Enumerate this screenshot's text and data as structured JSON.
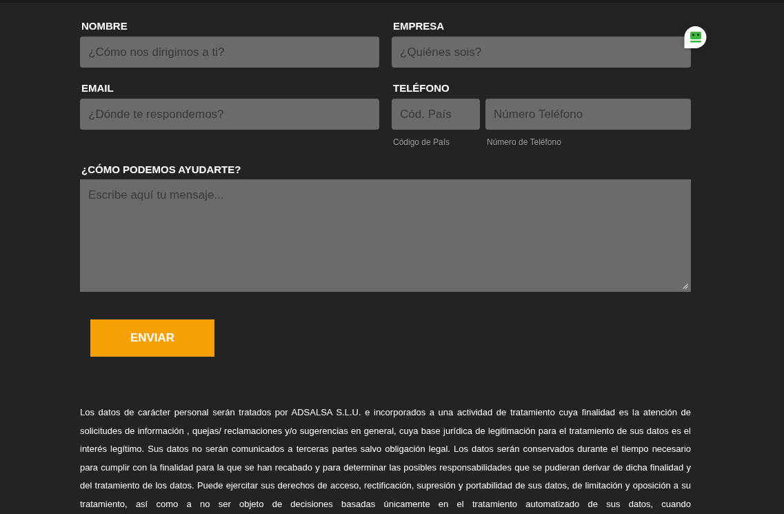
{
  "form": {
    "fields": [
      {
        "label": "NOMBRE",
        "kind": "text",
        "inputs": [
          {
            "placeholder": "¿Cómo nos dirigimos a ti?"
          }
        ]
      },
      {
        "label": "EMPRESA",
        "kind": "text",
        "inputs": [
          {
            "placeholder": "¿Quiénes sois?"
          }
        ]
      },
      {
        "label": "EMAIL",
        "kind": "text",
        "inputs": [
          {
            "placeholder": "¿Dónde te respondemos?"
          }
        ]
      },
      {
        "label": "TELÉFONO",
        "kind": "phone",
        "inputs": [
          {
            "placeholder": "Cód. País",
            "hint": "Código de País"
          },
          {
            "placeholder": "Número Teléfono",
            "hint": "Número de Teléfono"
          }
        ]
      }
    ],
    "message": {
      "label": "¿CÓMO PODEMOS AYUDARTE?",
      "placeholder": "Escribe aquí tu mensaje..."
    },
    "submit": "ENVIAR"
  },
  "privacy_notice": "Los datos de carácter personal serán tratados por ADSALSA S.L.U. e incorporados a una actividad de tratamiento cuya finalidad es la atención de solicitudes de información , quejas/ reclamaciones y/o sugerencias en general, cuya base jurídica de legitimación para el tratamiento de sus datos es el interés legítimo. Sus datos no serán comunicados a terceras partes salvo obligación legal. Los datos serán conservados durante el tiempo necesario para cumplir con la finalidad para la que se han recabado y para determinar las posibles responsabilidades que se pudieran derivar de dicha finalidad y del tratamiento de los datos. Puede ejercitar sus derechos de acceso, rectificación, supresión y portabilidad de sus datos, de limitación y oposición a su tratamiento, así como a no ser objeto de decisiones basadas únicamente en el tratamiento automatizado de sus datos, cuando"
}
